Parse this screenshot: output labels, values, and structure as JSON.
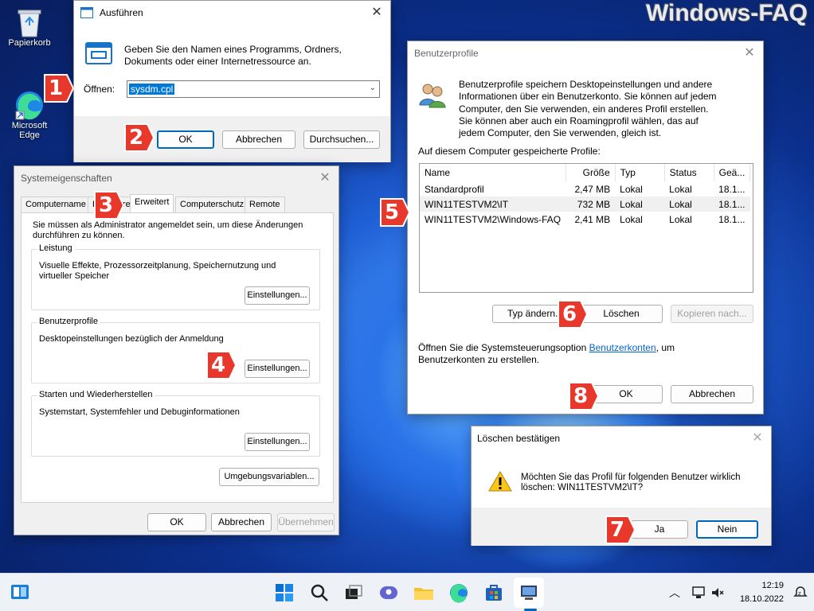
{
  "watermark": "Windows-FAQ",
  "desktop": {
    "recycle_bin": "Papierkorb",
    "edge": "Microsoft Edge"
  },
  "run": {
    "title": "Ausführen",
    "description": "Geben Sie den Namen eines Programms, Ordners, Dokuments oder einer Internetressource an.",
    "open_label": "Öffnen:",
    "open_value": "sysdm.cpl",
    "ok": "OK",
    "cancel": "Abbrechen",
    "browse": "Durchsuchen..."
  },
  "sysprops": {
    "title": "Systemeigenschaften",
    "tabs": [
      "Computername",
      "Hardware",
      "Erweitert",
      "Computerschutz",
      "Remote"
    ],
    "admin_note": "Sie müssen als Administrator angemeldet sein, um diese Änderungen durchführen zu können.",
    "performance": {
      "title": "Leistung",
      "text": "Visuelle Effekte, Prozessorzeitplanung, Speichernutzung und virtueller Speicher",
      "button": "Einstellungen..."
    },
    "profiles": {
      "title": "Benutzerprofile",
      "text": "Desktopeinstellungen bezüglich der Anmeldung",
      "button": "Einstellungen..."
    },
    "startup": {
      "title": "Starten und Wiederherstellen",
      "text": "Systemstart, Systemfehler und Debuginformationen",
      "button": "Einstellungen..."
    },
    "env_button": "Umgebungsvariablen...",
    "ok": "OK",
    "cancel": "Abbrechen",
    "apply": "Übernehmen"
  },
  "userprofiles": {
    "title": "Benutzerprofile",
    "description": "Benutzerprofile speichern Desktopeinstellungen und andere Informationen über ein Benutzerkonto. Sie können auf jedem Computer, den Sie verwenden, ein anderes Profil erstellen. Sie können aber auch ein Roamingprofil wählen, das auf jedem Computer, den Sie verwenden, gleich ist.",
    "list_label": "Auf diesem Computer gespeicherte Profile:",
    "columns": [
      "Name",
      "Größe",
      "Typ",
      "Status",
      "Geä..."
    ],
    "rows": [
      {
        "name": "Standardprofil",
        "size": "2,47 MB",
        "type": "Lokal",
        "status": "Lokal",
        "changed": "18.1..."
      },
      {
        "name": "WIN11TESTVM2\\IT",
        "size": "732 MB",
        "type": "Lokal",
        "status": "Lokal",
        "changed": "18.1..."
      },
      {
        "name": "WIN11TESTVM2\\Windows-FAQ",
        "size": "2,41 MB",
        "type": "Lokal",
        "status": "Lokal",
        "changed": "18.1..."
      }
    ],
    "change_type": "Typ ändern...",
    "delete": "Löschen",
    "copy_to": "Kopieren nach...",
    "footer_pre": "Öffnen Sie die Systemsteuerungsoption",
    "footer_link": "Benutzerkonten",
    "footer_post": ", um",
    "footer_line2": "Benutzerkonten zu erstellen.",
    "ok": "OK",
    "cancel": "Abbrechen"
  },
  "confirm": {
    "title": "Löschen bestätigen",
    "message_line1": "Möchten Sie das Profil für folgenden Benutzer wirklich",
    "message_line2": "löschen: WIN11TESTVM2\\IT?",
    "yes": "Ja",
    "no": "Nein"
  },
  "badges": [
    "1",
    "2",
    "3",
    "4",
    "5",
    "6",
    "7",
    "8"
  ],
  "taskbar": {
    "time": "12:19",
    "date": "18.10.2022"
  },
  "colors": {
    "badge_red": "#e8382c",
    "accent": "#0067c0"
  }
}
